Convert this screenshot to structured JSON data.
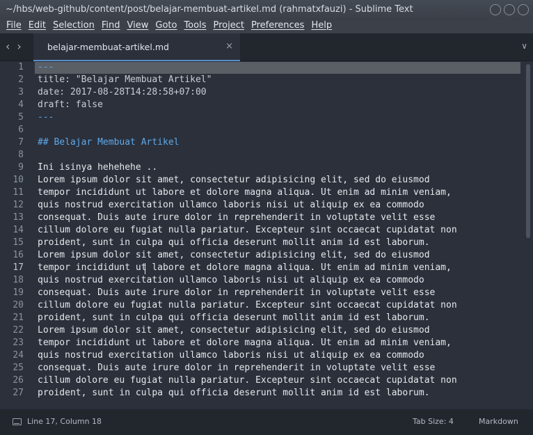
{
  "window": {
    "title": "~/hbs/web-github/content/post/belajar-membuat-artikel.md (rahmatxfauzi) - Sublime Text"
  },
  "menu": [
    "File",
    "Edit",
    "Selection",
    "Find",
    "View",
    "Goto",
    "Tools",
    "Project",
    "Preferences",
    "Help"
  ],
  "tabs": [
    {
      "label": "belajar-membuat-artikel.md",
      "close": "×"
    }
  ],
  "nav": {
    "back": "‹",
    "forward": "›",
    "dropdown": "∨"
  },
  "editor": {
    "active_line": 17,
    "lines": [
      {
        "n": "1",
        "text": "---",
        "cls": "c-blue"
      },
      {
        "n": "2",
        "text": "title: \"Belajar Membuat Artikel\"",
        "cls": "c-dim"
      },
      {
        "n": "3",
        "text": "date: 2017-08-28T14:28:58+07:00",
        "cls": "c-dim"
      },
      {
        "n": "4",
        "text": "draft: false",
        "cls": "c-dim"
      },
      {
        "n": "5",
        "text": "---",
        "cls": "c-blue"
      },
      {
        "n": "6",
        "text": "",
        "cls": ""
      },
      {
        "n": "7",
        "text": "## Belajar Membuat Artikel",
        "cls": "c-blue"
      },
      {
        "n": "8",
        "text": "",
        "cls": ""
      },
      {
        "n": "9",
        "text": "Ini isinya hehehehe ..",
        "cls": ""
      },
      {
        "n": "10",
        "text": "Lorem ipsum dolor sit amet, consectetur adipisicing elit, sed do eiusmod",
        "cls": ""
      },
      {
        "n": "11",
        "text": "tempor incididunt ut labore et dolore magna aliqua. Ut enim ad minim veniam,",
        "cls": ""
      },
      {
        "n": "12",
        "text": "quis nostrud exercitation ullamco laboris nisi ut aliquip ex ea commodo",
        "cls": ""
      },
      {
        "n": "13",
        "text": "consequat. Duis aute irure dolor in reprehenderit in voluptate velit esse",
        "cls": ""
      },
      {
        "n": "14",
        "text": "cillum dolore eu fugiat nulla pariatur. Excepteur sint occaecat cupidatat non",
        "cls": ""
      },
      {
        "n": "15",
        "text": "proident, sunt in culpa qui officia deserunt mollit anim id est laborum.",
        "cls": ""
      },
      {
        "n": "16",
        "text": "Lorem ipsum dolor sit amet, consectetur adipisicing elit, sed do eiusmod",
        "cls": ""
      },
      {
        "n": "17",
        "text": "tempor incididunt ut labore et dolore magna aliqua. Ut enim ad minim veniam,",
        "cls": ""
      },
      {
        "n": "18",
        "text": "quis nostrud exercitation ullamco laboris nisi ut aliquip ex ea commodo",
        "cls": ""
      },
      {
        "n": "19",
        "text": "consequat. Duis aute irure dolor in reprehenderit in voluptate velit esse",
        "cls": ""
      },
      {
        "n": "20",
        "text": "cillum dolore eu fugiat nulla pariatur. Excepteur sint occaecat cupidatat non",
        "cls": ""
      },
      {
        "n": "21",
        "text": "proident, sunt in culpa qui officia deserunt mollit anim id est laborum.",
        "cls": ""
      },
      {
        "n": "22",
        "text": "Lorem ipsum dolor sit amet, consectetur adipisicing elit, sed do eiusmod",
        "cls": ""
      },
      {
        "n": "23",
        "text": "tempor incididunt ut labore et dolore magna aliqua. Ut enim ad minim veniam,",
        "cls": ""
      },
      {
        "n": "24",
        "text": "quis nostrud exercitation ullamco laboris nisi ut aliquip ex ea commodo",
        "cls": ""
      },
      {
        "n": "25",
        "text": "consequat. Duis aute irure dolor in reprehenderit in voluptate velit esse",
        "cls": ""
      },
      {
        "n": "26",
        "text": "cillum dolore eu fugiat nulla pariatur. Excepteur sint occaecat cupidatat non",
        "cls": ""
      },
      {
        "n": "27",
        "text": "proident, sunt in culpa qui officia deserunt mollit anim id est laborum.",
        "cls": ""
      }
    ]
  },
  "status": {
    "position": "Line 17, Column 18",
    "tab_size": "Tab Size: 4",
    "syntax": "Markdown"
  },
  "colors": {
    "editor_bg": "#2b303b",
    "text": "#e6e8eb",
    "markup_accent": "#5fa8e8",
    "tab_accent": "#5a8fc9"
  }
}
